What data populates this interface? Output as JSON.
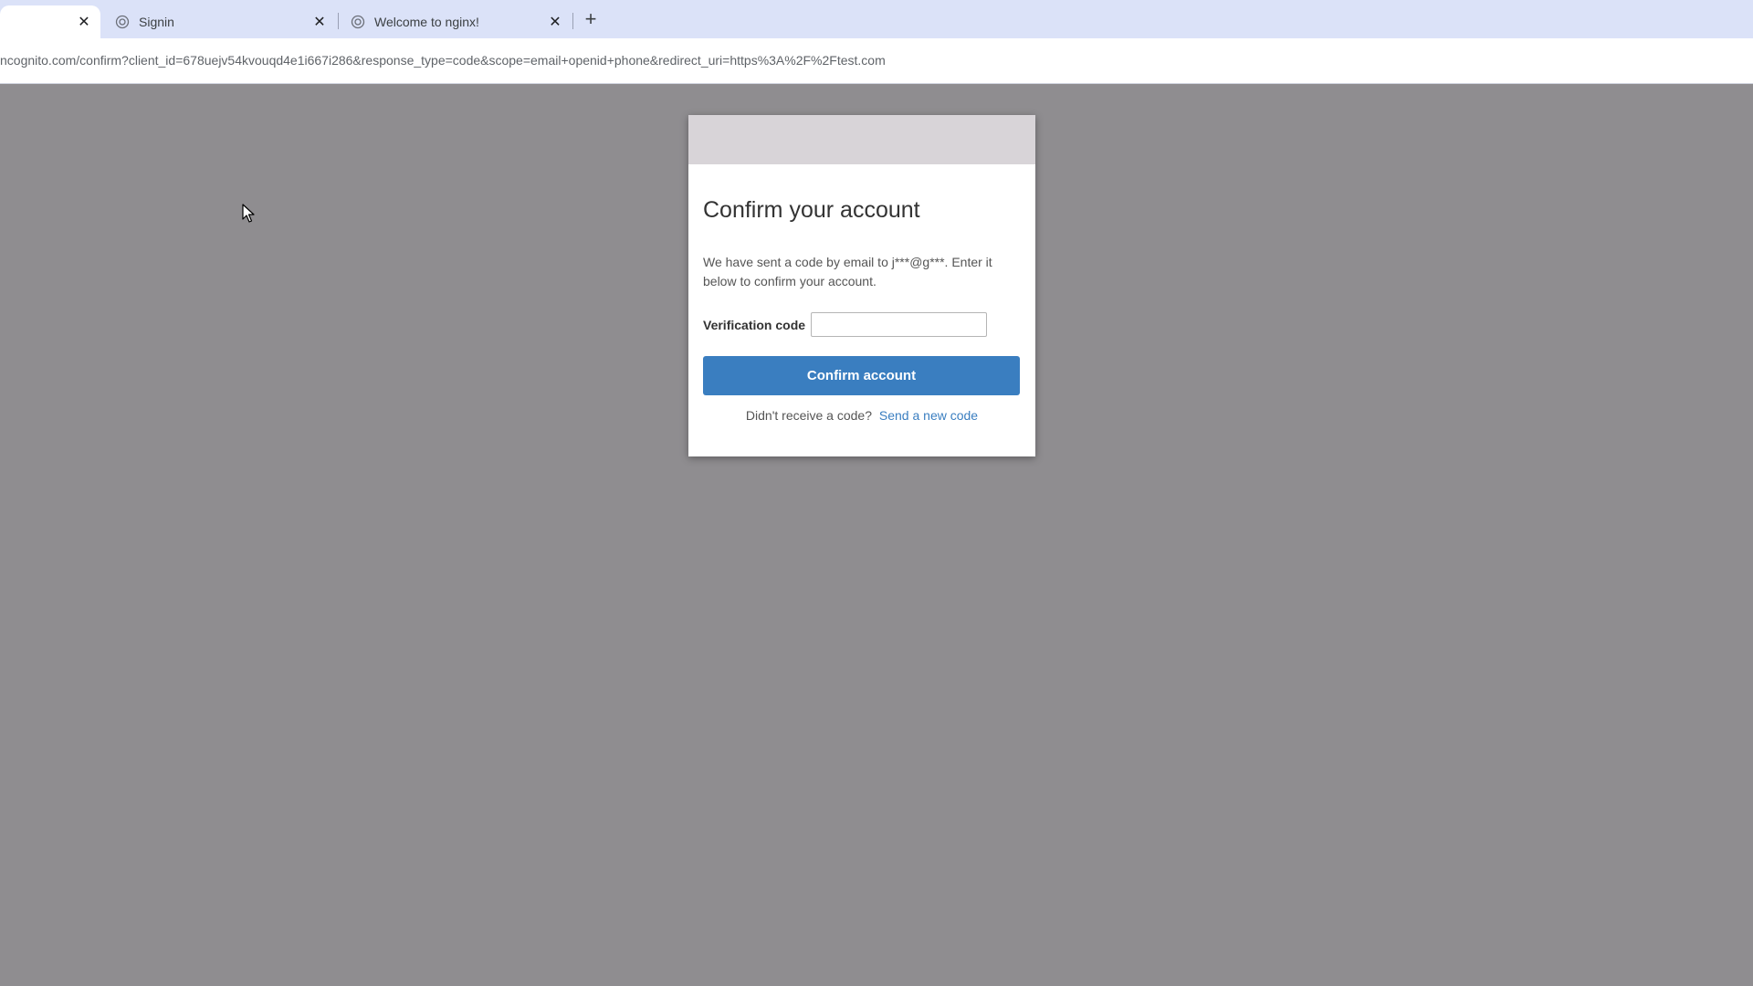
{
  "browser": {
    "tabs": [
      {
        "title": "",
        "close": "✕"
      },
      {
        "title": "Signin",
        "close": "✕"
      },
      {
        "title": "Welcome to nginx!",
        "close": "✕"
      }
    ],
    "new_tab": "+",
    "url": "ncognito.com/confirm?client_id=678uejv54kvouqd4e1i667i286&response_type=code&scope=email+openid+phone&redirect_uri=https%3A%2F%2Ftest.com"
  },
  "card": {
    "title": "Confirm your account",
    "message": "We have sent a code by email to j***@g***. Enter it below to confirm your account.",
    "code_label": "Verification code",
    "code_value": "",
    "code_placeholder": "",
    "confirm_label": "Confirm account",
    "resend_prompt": "Didn't receive a code?",
    "resend_link": "Send a new code"
  },
  "colors": {
    "page_background": "#8f8d90",
    "tab_strip": "#dbe2f8",
    "primary_button": "#3a7ec0",
    "link": "#3a7ec0"
  },
  "icons": {
    "tab_favicon": "globe-icon",
    "tab_close": "close-icon",
    "cursor": "mouse-pointer-icon"
  }
}
